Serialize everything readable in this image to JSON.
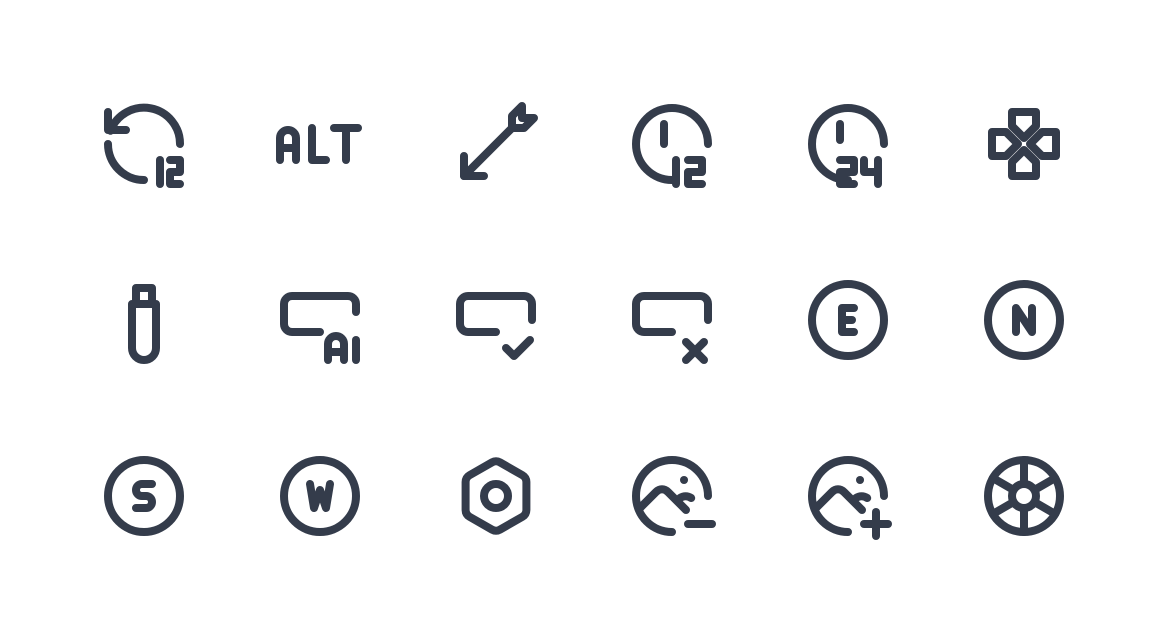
{
  "icon_color": "#343c4b",
  "background_color": "#ffffff",
  "icons": [
    "clockwise-12-icon",
    "alt-icon",
    "arrow-archery-icon",
    "clock-12-icon",
    "clock-24-icon",
    "gamepad-directions-icon",
    "usb-drive-icon",
    "rectangle-ai-icon",
    "rectangle-check-icon",
    "rectangle-x-icon",
    "compass-e-icon",
    "compass-n-icon",
    "compass-s-icon",
    "compass-w-icon",
    "hexagon-nut-icon",
    "photo-circle-minus-icon",
    "photo-circle-plus-icon",
    "wheel-icon"
  ]
}
